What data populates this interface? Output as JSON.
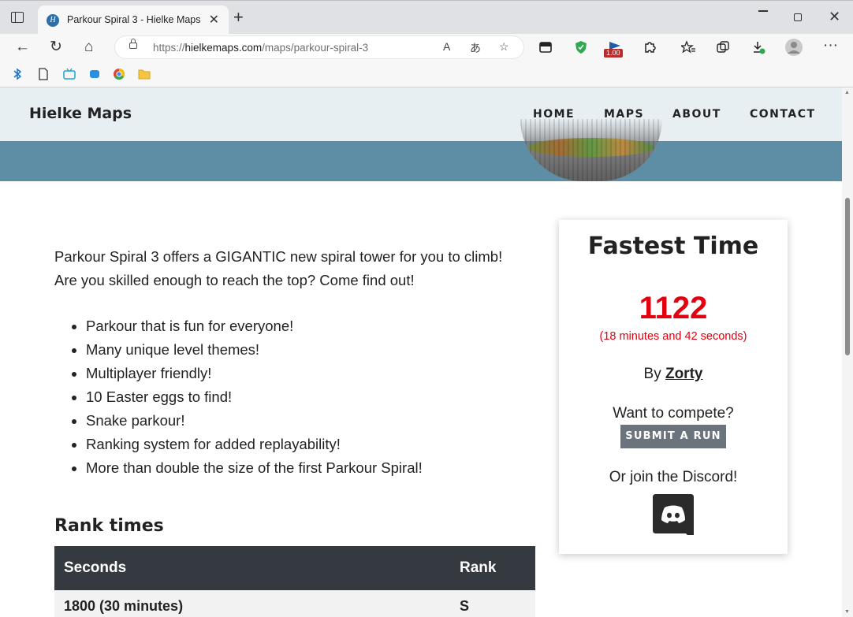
{
  "browser": {
    "tab_title": "Parkour Spiral 3 - Hielke Maps",
    "tab_favicon_letter": "H",
    "url_scheme": "https://",
    "url_host": "hielkemaps.com",
    "url_path": "/maps/parkour-spiral-3",
    "extension_badge": "1.00"
  },
  "site": {
    "brand": "Hielke Maps",
    "nav": [
      "HOME",
      "MAPS",
      "ABOUT",
      "CONTACT"
    ]
  },
  "content": {
    "intro": "Parkour Spiral 3 offers a GIGANTIC new spiral tower for you to climb! Are you skilled enough to reach the top? Come find out!",
    "features": [
      "Parkour that is fun for everyone!",
      "Many unique level themes!",
      "Multiplayer friendly!",
      "10 Easter eggs to find!",
      "Snake parkour!",
      "Ranking system for added replayability!",
      "More than double the size of the first Parkour Spiral!"
    ],
    "rank_heading": "Rank times",
    "table": {
      "headers": [
        "Seconds",
        "Rank"
      ],
      "rows": [
        [
          "1800 (30 minutes)",
          "S"
        ]
      ]
    }
  },
  "fastest": {
    "title": "Fastest Time",
    "time": "1122",
    "time_sub": "(18 minutes and 42 seconds)",
    "by_prefix": "By ",
    "by_name": "Zorty",
    "compete": "Want to compete?",
    "submit": "SUBMIT A RUN",
    "discord": "Or join the Discord!"
  },
  "colors": {
    "accent_red": "#e3000f",
    "rank_s": "#f0a30a",
    "header_bg": "#e7eff3",
    "hero_band": "#5e8ea5",
    "table_head": "#343a40"
  }
}
